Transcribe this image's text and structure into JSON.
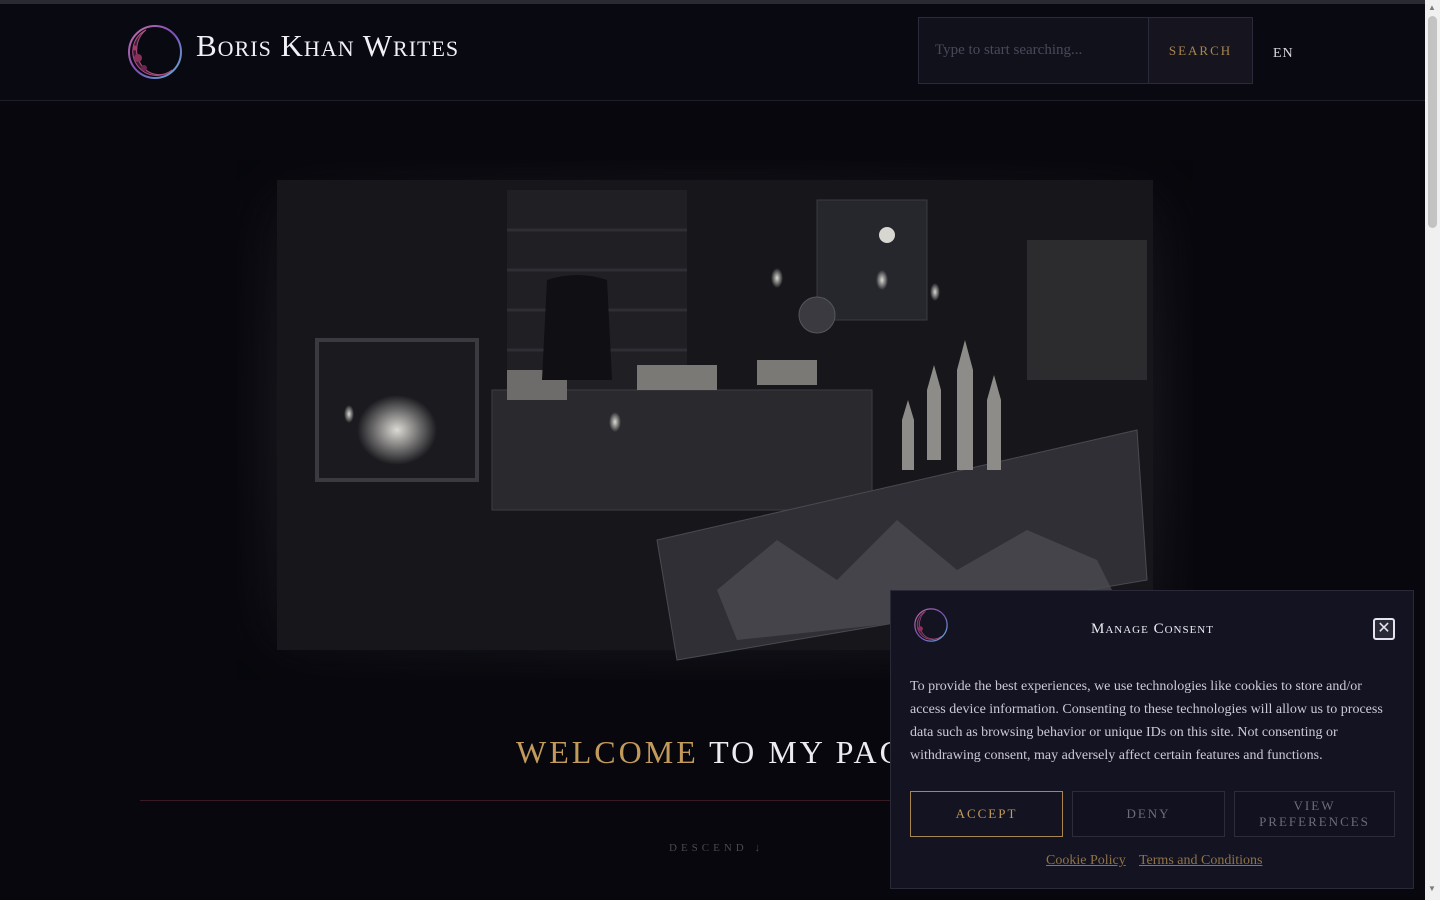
{
  "header": {
    "site_title": "Boris Khan Writes",
    "search": {
      "placeholder": "Type to start searching...",
      "button_label": "SEARCH"
    },
    "language": "EN"
  },
  "hero": {
    "welcome_accent": "WELCOME",
    "welcome_rest": " TO MY PAG",
    "descend_label": "DESCEND ↓"
  },
  "consent": {
    "title": "Manage Consent",
    "close_symbol": "✕",
    "text": "To provide the best experiences, we use technologies like cookies to store and/or access device information. Consenting to these technologies will allow us to process data such as browsing behavior or unique IDs on this site. Not consenting or withdrawing consent, may adversely affect certain features and functions.",
    "buttons": {
      "accept": "ACCEPT",
      "deny": "DENY",
      "preferences": "VIEW PREFERENCES"
    },
    "links": {
      "cookie_policy": "Cookie Policy",
      "terms": "Terms and Conditions"
    }
  },
  "colors": {
    "background": "#07070d",
    "accent_gold": "#c29a5b",
    "panel": "#141322"
  },
  "icons": {
    "logo": "crescent-moon-logo",
    "close": "close-icon",
    "scroll_up": "scroll-up-icon",
    "scroll_down": "scroll-down-icon"
  }
}
